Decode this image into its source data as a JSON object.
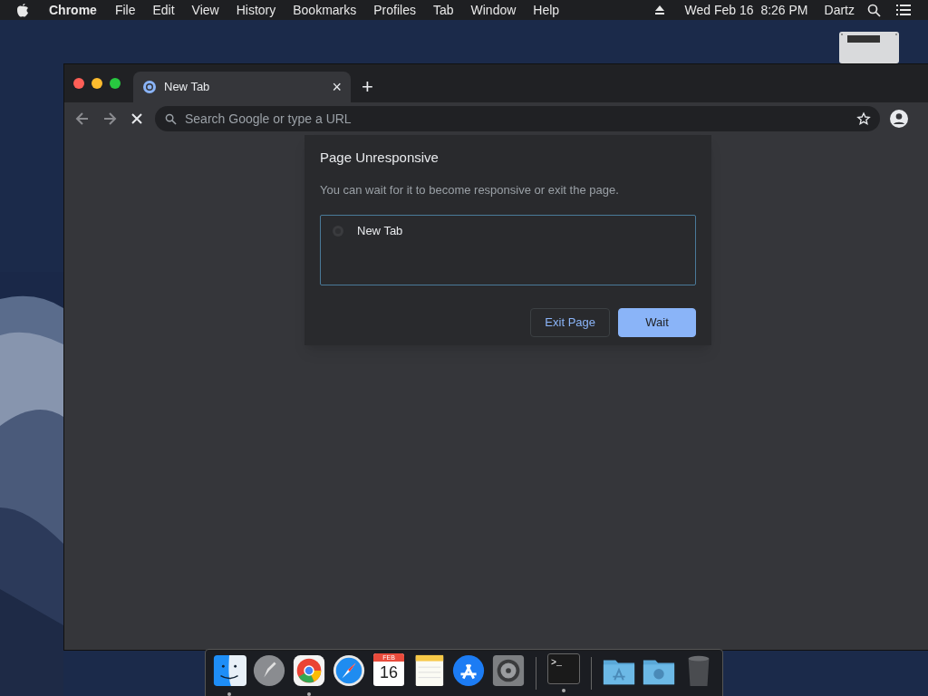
{
  "menu_bar": {
    "app": "Chrome",
    "items": [
      "File",
      "Edit",
      "View",
      "History",
      "Bookmarks",
      "Profiles",
      "Tab",
      "Window",
      "Help"
    ],
    "clock": "Wed Feb 16  8:26 PM",
    "user": "Dartz"
  },
  "browser": {
    "tabs": [
      {
        "title": "New Tab",
        "selected": true
      }
    ],
    "new_tab": "+",
    "close": "×",
    "address": {
      "placeholder": "Search Google or type a URL"
    }
  },
  "dialog": {
    "title": "Page Unresponsive",
    "message": "You can wait for it to become responsive or exit the page.",
    "pages": [
      "New Tab"
    ],
    "buttons": [
      {
        "label": "Exit Page",
        "kind": "secondary"
      },
      {
        "label": "Wait",
        "kind": "primary"
      }
    ]
  },
  "dock": [
    {
      "kind": "finder",
      "running": true
    },
    {
      "kind": "launchpad",
      "running": false
    },
    {
      "kind": "chrome",
      "running": true
    },
    {
      "kind": "safari",
      "running": false
    },
    {
      "kind": "calendar",
      "running": false,
      "month": "FEB",
      "day": "16"
    },
    {
      "kind": "notes",
      "running": false
    },
    {
      "kind": "appstore",
      "running": false
    },
    {
      "kind": "settings",
      "running": false
    },
    {
      "kind": "separator"
    },
    {
      "kind": "terminal",
      "running": true,
      "glyph": ">_"
    },
    {
      "kind": "separator"
    },
    {
      "kind": "folder-apps",
      "running": false
    },
    {
      "kind": "folder-downloads",
      "running": false
    },
    {
      "kind": "trash",
      "running": false
    }
  ]
}
